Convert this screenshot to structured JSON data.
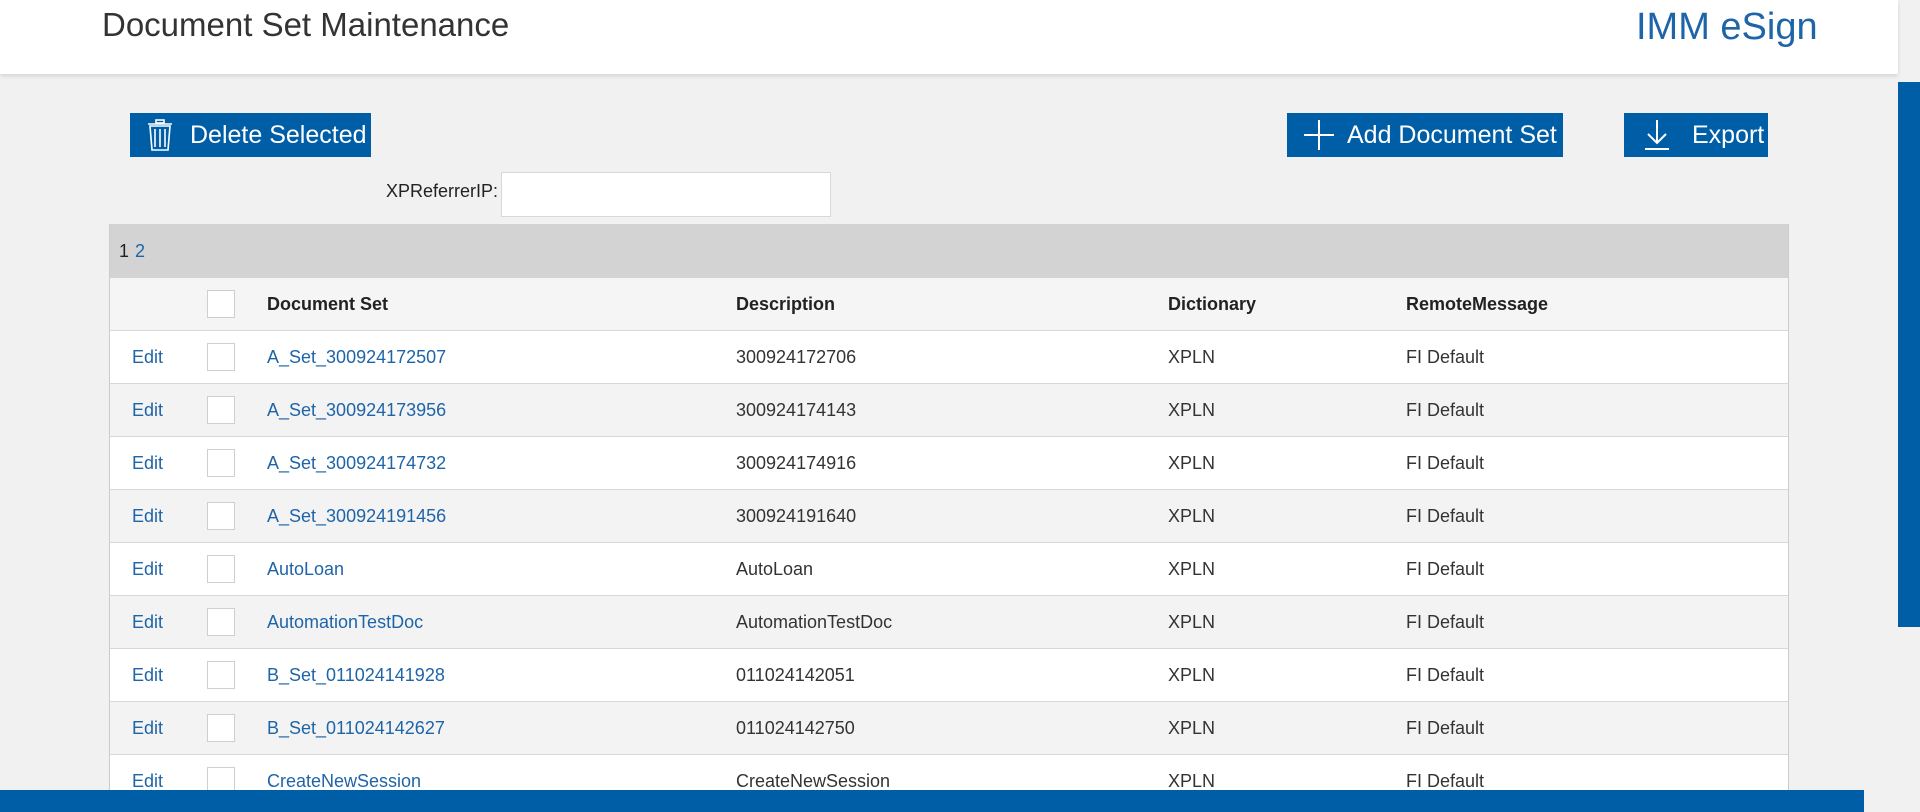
{
  "header": {
    "title": "Document Set Maintenance",
    "brand": "IMM eSign"
  },
  "toolbar": {
    "delete_label": "Delete Selected",
    "add_label": "Add Document Set",
    "export_label": "Export"
  },
  "filter": {
    "label": "XPReferrerIP:",
    "value": ""
  },
  "pager": {
    "current": "1",
    "pages": [
      "2"
    ]
  },
  "columns": {
    "document_set": "Document Set",
    "description": "Description",
    "dictionary": "Dictionary",
    "remote_message": "RemoteMessage"
  },
  "rows": [
    {
      "edit": "Edit",
      "document_set": "A_Set_300924172507",
      "description": "300924172706",
      "dictionary": "XPLN",
      "remote_message": "FI Default"
    },
    {
      "edit": "Edit",
      "document_set": "A_Set_300924173956",
      "description": "300924174143",
      "dictionary": "XPLN",
      "remote_message": "FI Default"
    },
    {
      "edit": "Edit",
      "document_set": "A_Set_300924174732",
      "description": "300924174916",
      "dictionary": "XPLN",
      "remote_message": "FI Default"
    },
    {
      "edit": "Edit",
      "document_set": "A_Set_300924191456",
      "description": "300924191640",
      "dictionary": "XPLN",
      "remote_message": "FI Default"
    },
    {
      "edit": "Edit",
      "document_set": "AutoLoan",
      "description": "AutoLoan",
      "dictionary": "XPLN",
      "remote_message": "FI Default"
    },
    {
      "edit": "Edit",
      "document_set": "AutomationTestDoc",
      "description": "AutomationTestDoc",
      "dictionary": "XPLN",
      "remote_message": "FI Default"
    },
    {
      "edit": "Edit",
      "document_set": "B_Set_011024141928",
      "description": "011024142051",
      "dictionary": "XPLN",
      "remote_message": "FI Default"
    },
    {
      "edit": "Edit",
      "document_set": "B_Set_011024142627",
      "description": "011024142750",
      "dictionary": "XPLN",
      "remote_message": "FI Default"
    },
    {
      "edit": "Edit",
      "document_set": "CreateNewSession",
      "description": "CreateNewSession",
      "dictionary": "XPLN",
      "remote_message": "FI Default"
    }
  ],
  "icons": {
    "delete": "trash-icon",
    "add": "plus-icon",
    "export": "download-icon"
  },
  "colors": {
    "accent": "#005ea6",
    "link": "#1e64a8"
  }
}
